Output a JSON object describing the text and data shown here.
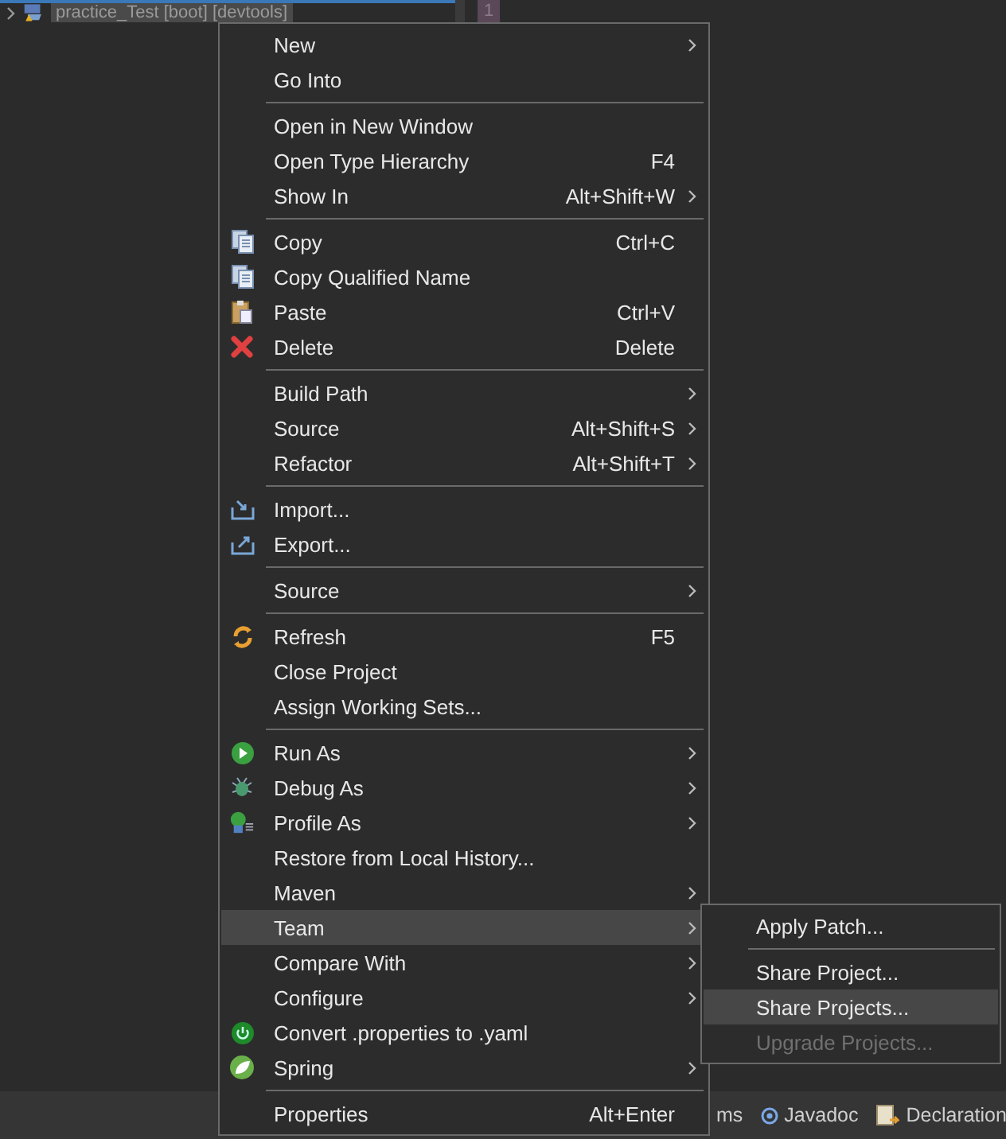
{
  "project_explorer": {
    "project": {
      "label": "practice_Test [boot] [devtools]",
      "selected": true
    }
  },
  "editor": {
    "line_number": "1"
  },
  "context_menu": {
    "items": [
      {
        "label": "New",
        "submenu": true,
        "selected": false
      },
      {
        "label": "Go Into",
        "selected": false
      },
      {
        "kind": "separator"
      },
      {
        "label": "Open in New Window",
        "selected": false
      },
      {
        "label": "Open Type Hierarchy",
        "shortcut": "F4",
        "selected": false
      },
      {
        "label": "Show In",
        "shortcut": "Alt+Shift+W",
        "submenu": true,
        "selected": false
      },
      {
        "kind": "separator"
      },
      {
        "label": "Copy",
        "shortcut": "Ctrl+C",
        "selected": false
      },
      {
        "label": "Copy Qualified Name",
        "selected": false
      },
      {
        "label": "Paste",
        "shortcut": "Ctrl+V",
        "selected": false
      },
      {
        "label": "Delete",
        "shortcut": "Delete",
        "selected": false
      },
      {
        "kind": "separator"
      },
      {
        "label": "Build Path",
        "submenu": true,
        "selected": false
      },
      {
        "label": "Source",
        "shortcut": "Alt+Shift+S",
        "submenu": true,
        "selected": false
      },
      {
        "label": "Refactor",
        "shortcut": "Alt+Shift+T",
        "submenu": true,
        "selected": false
      },
      {
        "kind": "separator"
      },
      {
        "label": "Import...",
        "selected": false
      },
      {
        "label": "Export...",
        "selected": false
      },
      {
        "kind": "separator"
      },
      {
        "label": "Source",
        "submenu": true,
        "selected": false
      },
      {
        "kind": "separator"
      },
      {
        "label": "Refresh",
        "shortcut": "F5",
        "selected": false
      },
      {
        "label": "Close Project",
        "selected": false
      },
      {
        "label": "Assign Working Sets...",
        "selected": false
      },
      {
        "kind": "separator"
      },
      {
        "label": "Run As",
        "submenu": true,
        "selected": false
      },
      {
        "label": "Debug As",
        "submenu": true,
        "selected": false
      },
      {
        "label": "Profile As",
        "submenu": true,
        "selected": false
      },
      {
        "label": "Restore from Local History...",
        "selected": false
      },
      {
        "label": "Maven",
        "submenu": true,
        "selected": false
      },
      {
        "label": "Team",
        "submenu": true,
        "selected": true
      },
      {
        "label": "Compare With",
        "submenu": true,
        "selected": false
      },
      {
        "label": "Configure",
        "submenu": true,
        "selected": false
      },
      {
        "label": "Convert .properties to .yaml",
        "selected": false
      },
      {
        "label": "Spring",
        "submenu": true,
        "selected": false
      },
      {
        "kind": "separator"
      },
      {
        "label": "Properties",
        "shortcut": "Alt+Enter",
        "selected": false
      }
    ]
  },
  "team_submenu": {
    "items": [
      {
        "label": "Apply Patch...",
        "selected": false,
        "disabled": false
      },
      {
        "kind": "separator"
      },
      {
        "label": "Share Project...",
        "selected": false,
        "disabled": false
      },
      {
        "label": "Share Projects...",
        "selected": true,
        "disabled": false
      },
      {
        "label": "Upgrade Projects...",
        "selected": false,
        "disabled": true
      }
    ]
  },
  "bottom_tabs": [
    {
      "label": "ms"
    },
    {
      "label": "Javadoc"
    },
    {
      "label": "Declaration"
    }
  ]
}
